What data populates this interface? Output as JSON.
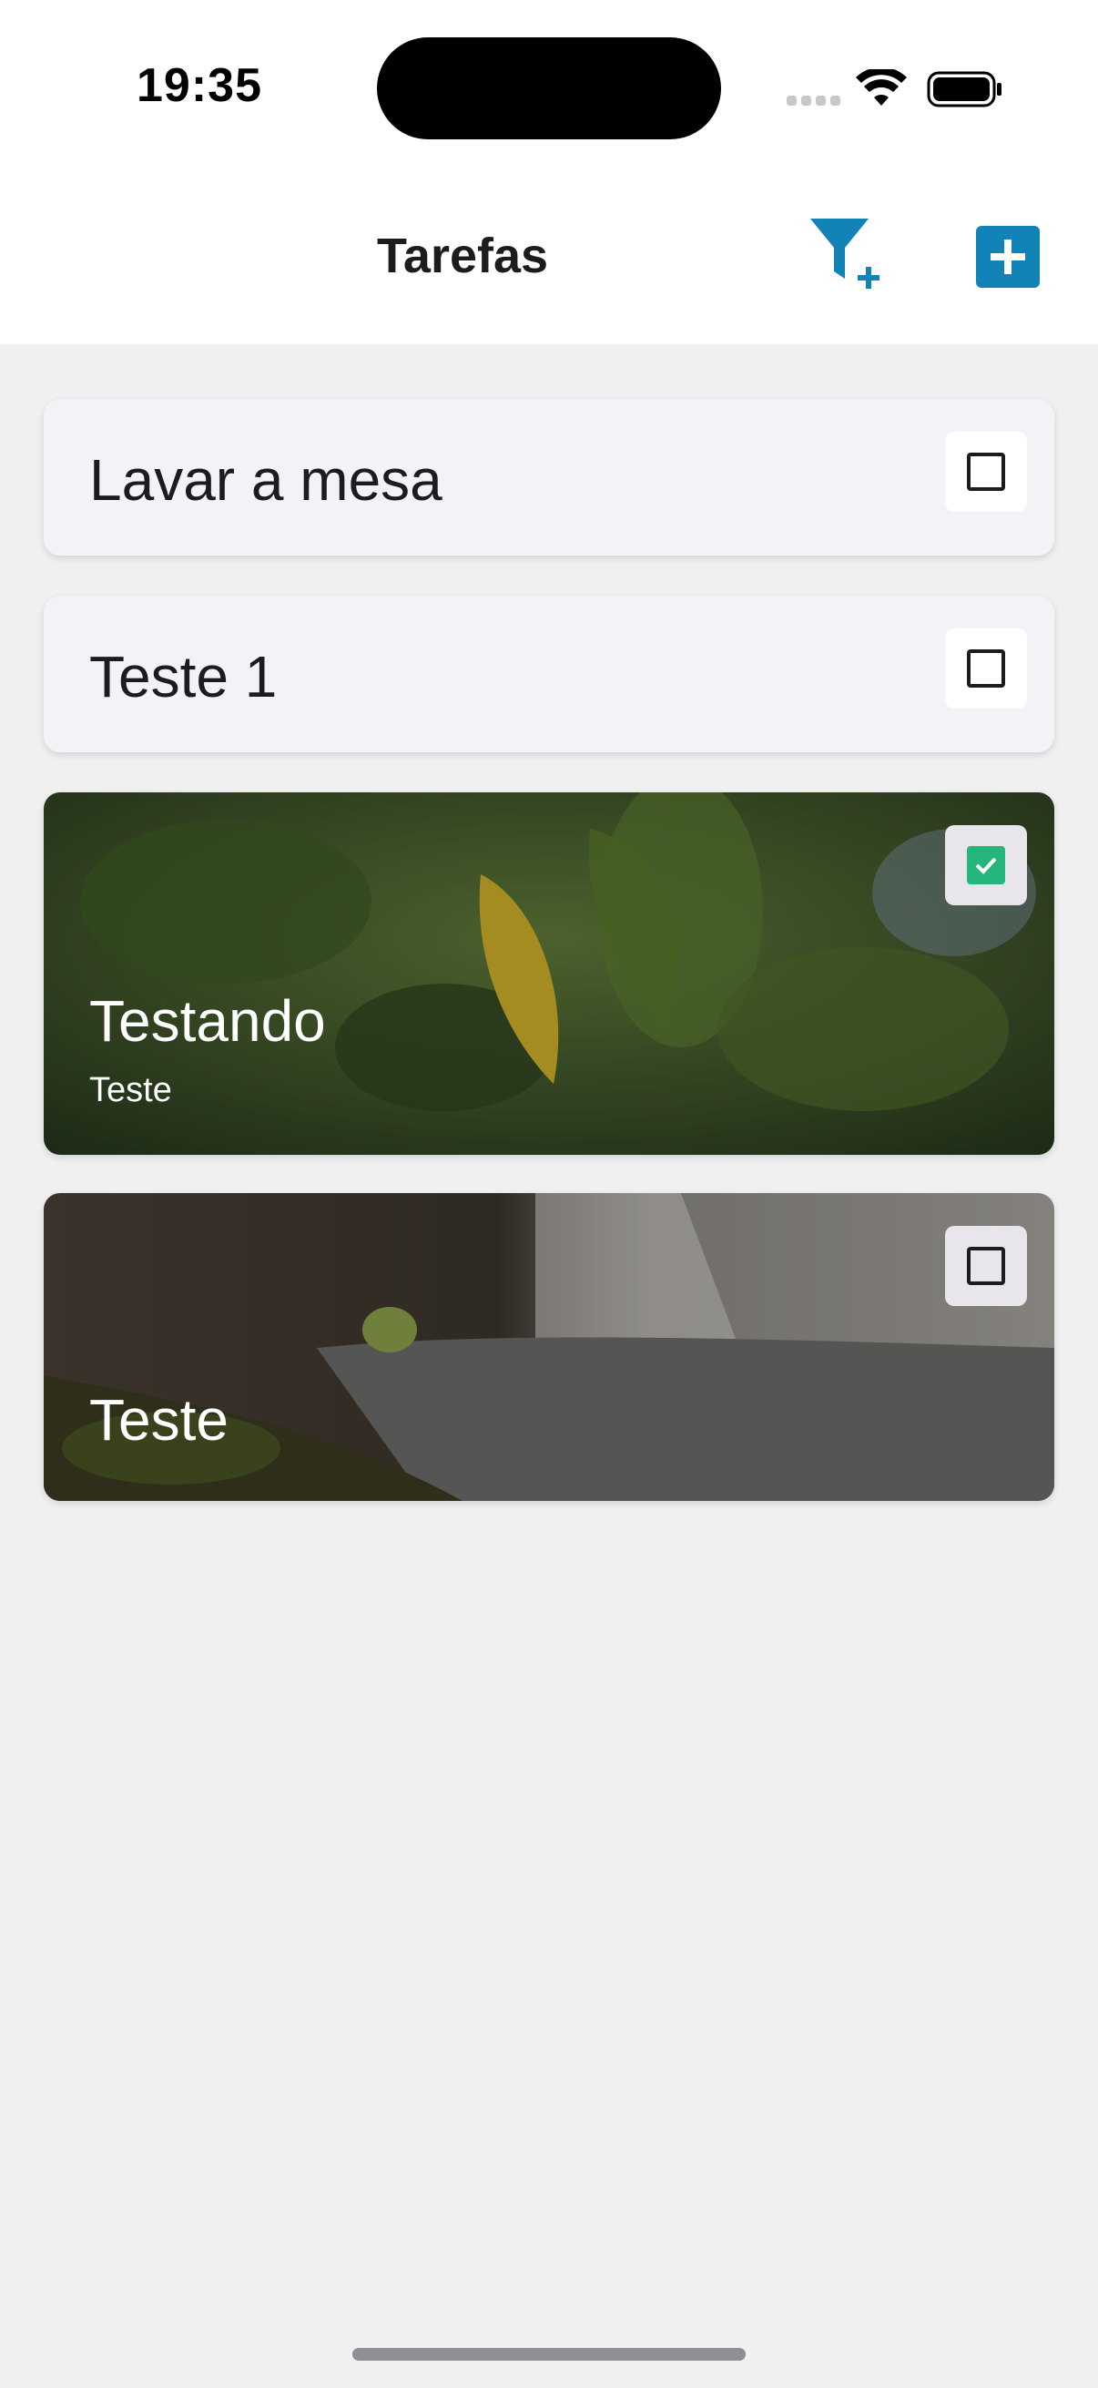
{
  "status_bar": {
    "time": "19:35",
    "icons": [
      "signal-icon",
      "wifi-icon",
      "battery-icon"
    ]
  },
  "nav": {
    "title": "Tarefas",
    "filter_icon": "filter-plus-icon",
    "add_icon": "plus-square-icon",
    "accent_color": "#1183b6"
  },
  "tasks": [
    {
      "title": "Lavar a mesa",
      "subtitle": "",
      "checked": false
    },
    {
      "title": "Teste 1",
      "subtitle": "",
      "checked": false
    },
    {
      "title": "Testando",
      "subtitle": "Teste",
      "checked": true
    },
    {
      "title": "Teste",
      "subtitle": "",
      "checked": false
    }
  ],
  "colors": {
    "check_green": "#25b67c",
    "card_bg": "#f4f1f7",
    "page_bg": "#f0f0f0"
  }
}
